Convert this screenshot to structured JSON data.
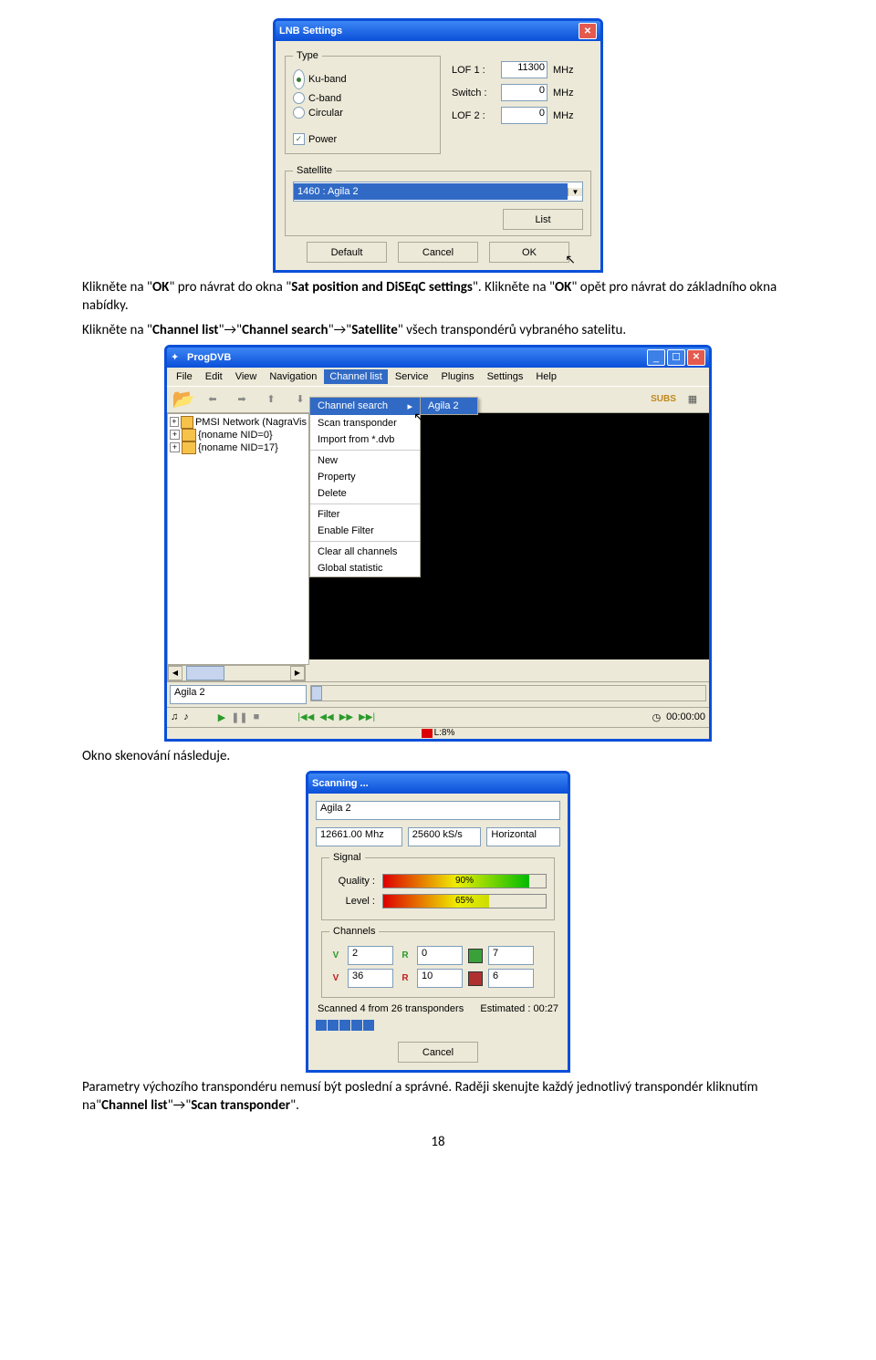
{
  "lnb": {
    "title": "LNB Settings",
    "type_legend": "Type",
    "ku": "Ku-band",
    "c": "C-band",
    "circ": "Circular",
    "power": "Power",
    "lof1_lbl": "LOF 1 :",
    "lof1_val": "11300",
    "switch_lbl": "Switch :",
    "switch_val": "0",
    "lof2_lbl": "LOF 2 :",
    "lof2_val": "0",
    "mhz": "MHz",
    "sat_legend": "Satellite",
    "sat_val": "1460 : Agila 2",
    "list_btn": "List",
    "default_btn": "Default",
    "cancel_btn": "Cancel",
    "ok_btn": "OK"
  },
  "p1a": "Klikněte na \"",
  "p1b": "OK",
  "p1c": "\" pro návrat do okna \"",
  "p1d": "Sat position and DiSEqC settings",
  "p1e": "\". Klikněte na \"",
  "p1f": "OK",
  "p1g": "\" opět pro návrat do základního okna nabídky.",
  "p2a": "Klikněte na \"",
  "p2b": "Channel list",
  "p2c": "\"→\"",
  "p2d": "Channel search",
  "p2e": "\"→\"",
  "p2f": "Satellite",
  "p2g": "\" všech transpondérů vybraného satelitu.",
  "prog": {
    "title": "ProgDVB",
    "menu": {
      "file": "File",
      "edit": "Edit",
      "view": "View",
      "nav": "Navigation",
      "cl": "Channel list",
      "serv": "Service",
      "plug": "Plugins",
      "set": "Settings",
      "help": "Help"
    },
    "dd": {
      "cs": "Channel search",
      "st": "Scan transponder",
      "imp": "Import from *.dvb",
      "new": "New",
      "prop": "Property",
      "del": "Delete",
      "filt": "Filter",
      "ef": "Enable Filter",
      "cac": "Clear all channels",
      "gs": "Global statistic"
    },
    "sub": "Agila 2",
    "tree": {
      "n1": "PMSI Network (NagraVis",
      "n2": "{noname NID=0}",
      "n3": "{noname NID=17}"
    },
    "status": "Agila 2",
    "pct": "L:8%",
    "time": "00:00:00"
  },
  "p3": "Okno skenování následuje.",
  "scan": {
    "title": "Scanning ...",
    "sat": "Agila 2",
    "freq": "12661.00 Mhz",
    "sr": "25600 kS/s",
    "pol": "Horizontal",
    "sig_legend": "Signal",
    "q_lbl": "Quality :",
    "q_val": "90%",
    "l_lbl": "Level :",
    "l_val": "65%",
    "ch_legend": "Channels",
    "v1": "2",
    "r1": "0",
    "d1": "7",
    "v2": "36",
    "r2": "10",
    "d2": "6",
    "scanned": "Scanned 4 from 26 transponders",
    "est": "Estimated : 00:27",
    "cancel": "Cancel"
  },
  "p4a": " Parametry výchozího transpondéru nemusí být poslední a správné. Raději skenujte každý jednotlivý transpondér kliknutím na\"",
  "p4b": "Channel list",
  "p4c": "\"→\"",
  "p4d": "Scan transponder",
  "p4e": "\".",
  "pagen": "18"
}
